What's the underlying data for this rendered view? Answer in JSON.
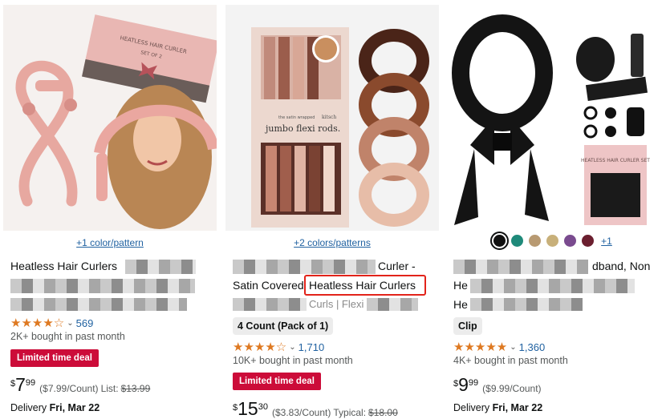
{
  "products": [
    {
      "color_options": "+1 color/pattern",
      "title_visible": "Heatless Hair Curlers",
      "rating_stars": "★★★★☆",
      "review_count": "569",
      "bought": "2K+ bought in past month",
      "deal_badge": "Limited time deal",
      "price_symbol": "$",
      "price_whole": "7",
      "price_fraction": "99",
      "price_per": "($7.99/Count)",
      "list_label": "List:",
      "list_price": "$13.99",
      "delivery_label": "Delivery",
      "delivery_date": "Fri, Mar 22",
      "image_text": {
        "box_brand": "HEATLESS HAIR CURLER",
        "box_sub": "SET OF 2"
      }
    },
    {
      "color_options": "+2 colors/patterns",
      "title_line1_suffix": "Curler -",
      "title_line2_prefix": "Satin Covered",
      "title_highlight": "Heatless Hair Curlers",
      "title_line3_fragment": "Curls | Flexi Rods",
      "size_chip": "4 Count (Pack of 1)",
      "rating_stars": "★★★★☆",
      "review_count": "1,710",
      "bought": "10K+ bought in past month",
      "deal_badge": "Limited time deal",
      "price_symbol": "$",
      "price_whole": "15",
      "price_fraction": "30",
      "price_per": "($3.83/Count)",
      "list_label": "Typical:",
      "list_price": "$18.00",
      "image_text": {
        "box_small": "the satin wrapped",
        "box_title": "jumbo flexi rods.",
        "box_brand": "kitsch"
      }
    },
    {
      "swatch_colors": [
        "#111111",
        "#1f8a7a",
        "#b89a72",
        "#c8b07a",
        "#7a4b8f",
        "#6b1f2f"
      ],
      "swatch_more": "+1",
      "title_line1_suffix": "dband, Non",
      "title_line2_prefix": "He",
      "title_line3_prefix": "He",
      "size_chip": "Clip",
      "rating_stars": "★★★★★",
      "review_count": "1,360",
      "bought": "4K+ bought in past month",
      "price_symbol": "$",
      "price_whole": "9",
      "price_fraction": "99",
      "price_per": "($9.99/Count)",
      "delivery_label": "Delivery",
      "delivery_date": "Fri, Mar 22",
      "image_text": {
        "box_title": "HEATLESS HAIR CURLER SET"
      }
    }
  ],
  "colors": {
    "link": "#2162a1",
    "star": "#de7921",
    "deal": "#cc0c39",
    "highlight_box": "#e2231a"
  }
}
